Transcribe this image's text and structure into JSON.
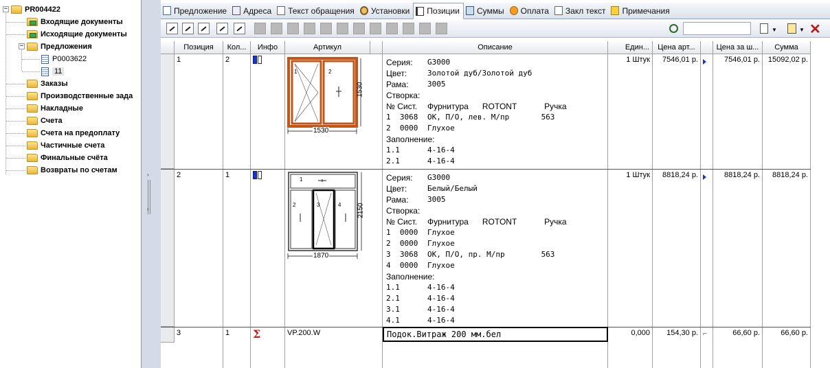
{
  "tree": {
    "root": "PR004422",
    "items": [
      {
        "label": "Входящие документы",
        "icon": "folder-green-icon"
      },
      {
        "label": "Исходящие документы",
        "icon": "folder-green-icon"
      },
      {
        "label": "Предложения",
        "icon": "folder-open-icon"
      },
      {
        "label": "P0003622",
        "icon": "document-icon"
      },
      {
        "label": "11",
        "icon": "document-icon"
      },
      {
        "label": "Заказы",
        "icon": "folder-icon"
      },
      {
        "label": "Производственные зада",
        "icon": "folder-icon"
      },
      {
        "label": "Накладные",
        "icon": "folder-icon"
      },
      {
        "label": "Счета",
        "icon": "folder-icon"
      },
      {
        "label": "Счета на предоплату",
        "icon": "folder-icon"
      },
      {
        "label": "Частичные счета",
        "icon": "folder-icon"
      },
      {
        "label": "Финальные счёта",
        "icon": "folder-icon"
      },
      {
        "label": "Возвраты по счетам",
        "icon": "folder-icon"
      }
    ]
  },
  "tabs": [
    {
      "label": "Предложение",
      "icon": "document-icon"
    },
    {
      "label": "Адреса",
      "icon": "address-card-icon"
    },
    {
      "label": "Текст обращения",
      "icon": "text-document-icon"
    },
    {
      "label": "Установки",
      "icon": "settings-gears-icon"
    },
    {
      "label": "Позиции",
      "icon": "book-icon",
      "active": true
    },
    {
      "label": "Суммы",
      "icon": "calculator-icon"
    },
    {
      "label": "Оплата",
      "icon": "coin-icon"
    },
    {
      "label": "Закл текст",
      "icon": "text-document-icon"
    },
    {
      "label": "Примечания",
      "icon": "note-icon"
    }
  ],
  "search": {
    "value": ""
  },
  "columns": [
    "Позиция",
    "Кол...",
    "Инфо",
    "Артикул",
    "Описание",
    "Един...",
    "Цена арт...",
    "Цена за ш...",
    "Сумма"
  ],
  "rows": [
    {
      "position": "1",
      "qty": "2",
      "unit": "1 Штук",
      "price": "7546,01 р.",
      "unit_price": "7546,01 р.",
      "sum": "15092,02 р.",
      "drawing": {
        "width_label": "1530",
        "height_label": "1530",
        "sash1": "1",
        "sash2": "2"
      },
      "desc": [
        [
          "Серия:",
          "G3000"
        ],
        [
          "Цвет:",
          "Золотой дуб/Золотой дуб"
        ],
        [
          "Рама:",
          "3005"
        ],
        [
          "Створка:",
          ""
        ],
        [
          "№ Сист.",
          "Фурнитура      ROTONT            Ручка"
        ],
        [
          "1  3068",
          "ОК, П/О, лев. М/пр       563"
        ],
        [
          "2  0000",
          "Глухое"
        ],
        [
          "Заполнение:",
          ""
        ],
        [
          "1.1",
          "4-16-4"
        ],
        [
          "2.1",
          "4-16-4"
        ]
      ]
    },
    {
      "position": "2",
      "qty": "1",
      "unit": "1 Штук",
      "price": "8818,24 р.",
      "unit_price": "8818,24 р.",
      "sum": "8818,24 р.",
      "drawing": {
        "width_label": "1870",
        "height_label": "2150",
        "sash1": "1",
        "sash2": "2",
        "sash3": "3",
        "sash4": "4"
      },
      "desc": [
        [
          "Серия:",
          "G3000"
        ],
        [
          "Цвет:",
          "Белый/Белый"
        ],
        [
          "Рама:",
          "3005"
        ],
        [
          "Створка:",
          ""
        ],
        [
          "№ Сист.",
          "Фурнитура      ROTONT            Ручка"
        ],
        [
          "1  0000",
          "Глухое"
        ],
        [
          "2  0000",
          "Глухое"
        ],
        [
          "3  3068",
          "ОК, П/О, пр. М/пр        563"
        ],
        [
          "4  0000",
          "Глухое"
        ],
        [
          "Заполнение:",
          ""
        ],
        [
          "1.1",
          "4-16-4"
        ],
        [
          "2.1",
          "4-16-4"
        ],
        [
          "3.1",
          "4-16-4"
        ],
        [
          "4.1",
          "4-16-4"
        ]
      ]
    },
    {
      "position": "3",
      "qty": "1",
      "article": "VP.200.W",
      "unit": "0,000",
      "price": "154,30 р.",
      "unit_price": "66,60 р.",
      "sum": "66,60 р.",
      "desc_single": "Подок.Витраж 200 мм.бел"
    }
  ]
}
